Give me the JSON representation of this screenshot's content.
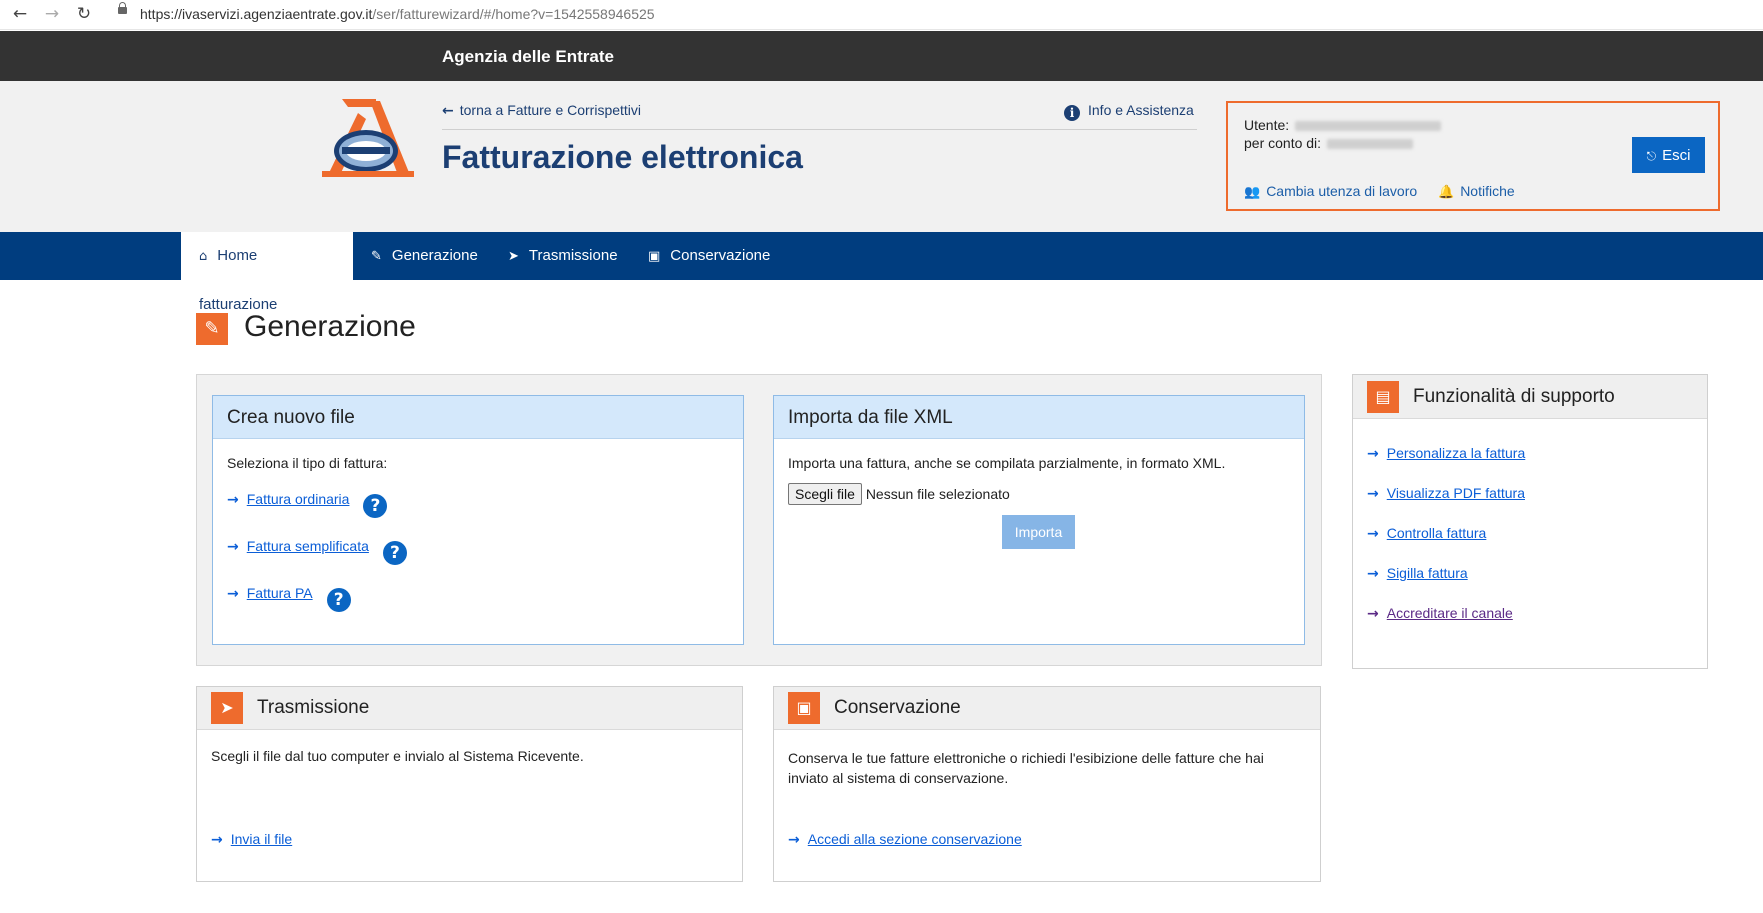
{
  "browser": {
    "url_host": "https://ivaservizi.agenziaentrate.gov.it",
    "url_path": "/ser/fatturewizard/#/home?v=1542558946525"
  },
  "topbar": {
    "agency": "Agenzia delle Entrate"
  },
  "header": {
    "back_link": "torna a Fatture e Corrispettivi",
    "info_link": "Info e Assistenza",
    "title": "Fatturazione elettronica"
  },
  "userbox": {
    "user_label": "Utente:",
    "behalf_label": "per conto di:",
    "logout": "Esci",
    "change_user": "Cambia utenza di lavoro",
    "notifications": "Notifiche"
  },
  "nav": {
    "tabs": [
      {
        "label": "Home fatturazione",
        "icon": "home-icon"
      },
      {
        "label": "Generazione",
        "icon": "pencil-icon"
      },
      {
        "label": "Trasmissione",
        "icon": "send-icon"
      },
      {
        "label": "Conservazione",
        "icon": "archive-icon"
      }
    ]
  },
  "page": {
    "title": "Generazione"
  },
  "crea": {
    "title": "Crea nuovo file",
    "intro": "Seleziona il tipo di fattura:",
    "links": [
      "Fattura ordinaria",
      "Fattura semplificata",
      "Fattura PA"
    ]
  },
  "importa": {
    "title": "Importa da file XML",
    "intro": "Importa una fattura, anche se compilata parzialmente, in formato XML.",
    "file_button": "Scegli file",
    "file_status": "Nessun file selezionato",
    "import_button": "Importa"
  },
  "supporto": {
    "title": "Funzionalità di supporto",
    "links": [
      "Personalizza la fattura",
      "Visualizza PDF fattura",
      "Controlla fattura",
      "Sigilla fattura",
      "Accreditare il canale"
    ]
  },
  "trasmissione": {
    "title": "Trasmissione",
    "text": "Scegli il file dal tuo computer e invialo al Sistema Ricevente.",
    "link": "Invia il file"
  },
  "conservazione": {
    "title": "Conservazione",
    "text": "Conserva le tue fatture elettroniche o richiedi l'esibizione delle fatture che hai inviato al sistema di conservazione.",
    "link": "Accedi alla sezione conservazione"
  },
  "colors": {
    "brand_blue": "#003d7f",
    "accent_orange": "#ee6b2d",
    "link_blue": "#0b5ed7"
  }
}
